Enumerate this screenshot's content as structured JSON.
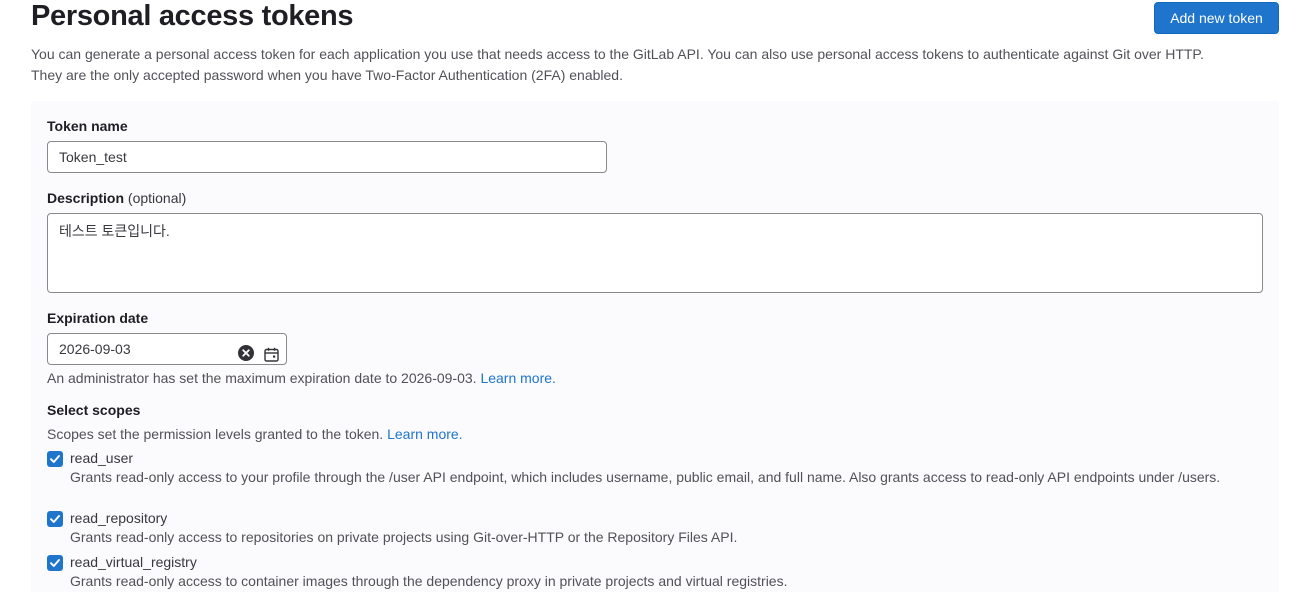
{
  "header": {
    "title": "Personal access tokens",
    "add_button": "Add new token"
  },
  "intro": {
    "line1": "You can generate a personal access token for each application you use that needs access to the GitLab API. You can also use personal access tokens to authenticate against Git over HTTP.",
    "line2": "They are the only accepted password when you have Two-Factor Authentication (2FA) enabled."
  },
  "form": {
    "token_name": {
      "label": "Token name",
      "value": "Token_test"
    },
    "description": {
      "label": "Description",
      "optional": "(optional)",
      "value": "테스트 토큰입니다."
    },
    "expiration": {
      "label": "Expiration date",
      "value": "2026-09-03",
      "help": "An administrator has set the maximum expiration date to 2026-09-03.",
      "help_link": "Learn more."
    },
    "scopes": {
      "label": "Select scopes",
      "help": "Scopes set the permission levels granted to the token.",
      "help_link": "Learn more.",
      "items": [
        {
          "name": "read_user",
          "checked": true,
          "description": "Grants read-only access to your profile through the /user API endpoint, which includes username, public email, and full name. Also grants access to read-only API endpoints under /users."
        },
        {
          "name": "read_repository",
          "checked": true,
          "description": "Grants read-only access to repositories on private projects using Git-over-HTTP or the Repository Files API."
        },
        {
          "name": "read_virtual_registry",
          "checked": true,
          "description": "Grants read-only access to container images through the dependency proxy in private projects and virtual registries."
        }
      ]
    }
  },
  "colors": {
    "primary": "#1f75cb",
    "form_background": "#fbfafd",
    "text_heading": "#1f1e24",
    "text_secondary": "#535158"
  },
  "icons": {
    "clear": "clear-icon",
    "calendar": "calendar-icon",
    "check": "check-icon"
  }
}
